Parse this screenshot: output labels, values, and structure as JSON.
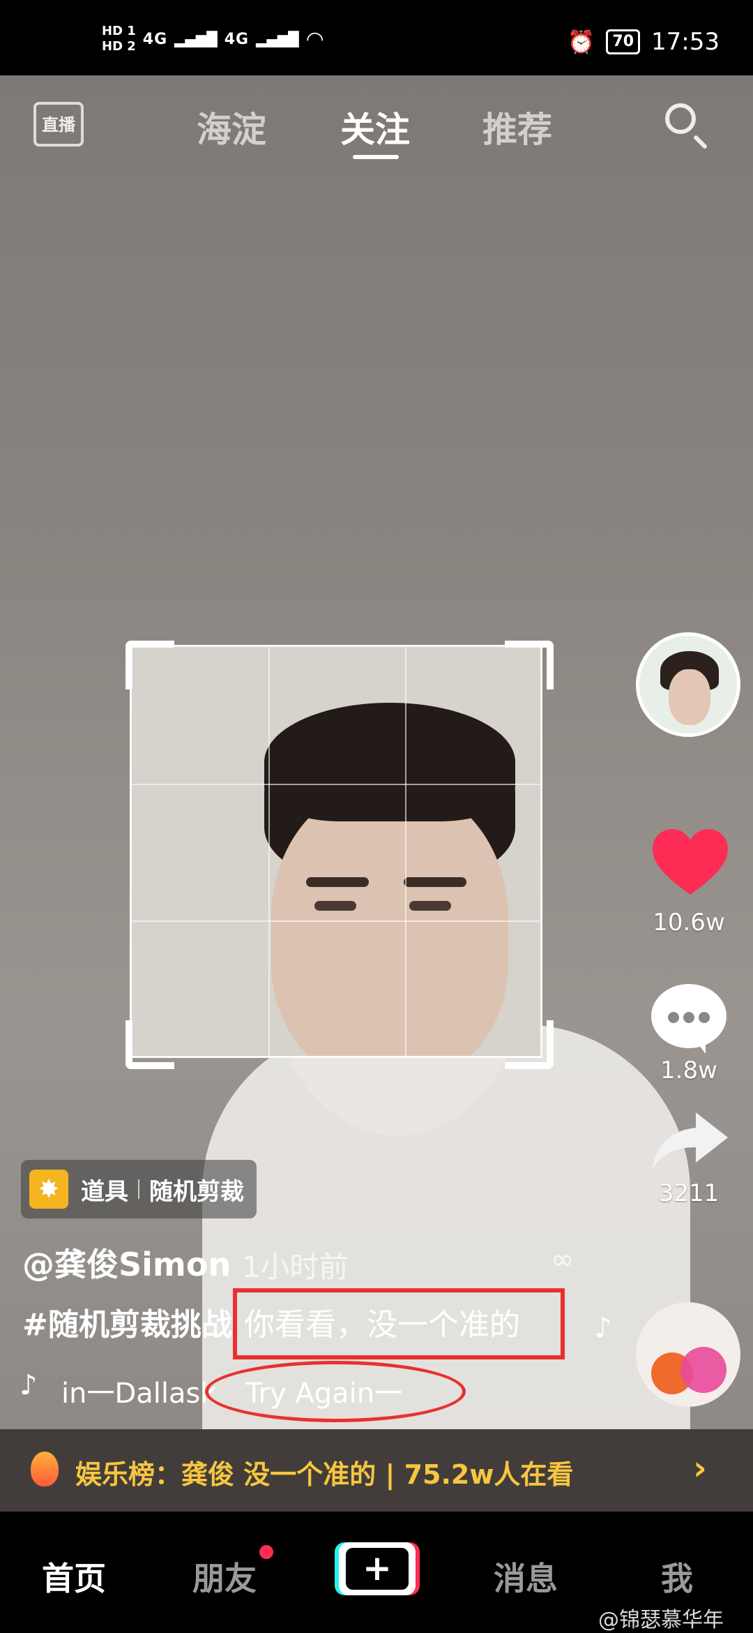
{
  "status_bar": {
    "sim1": "HD 1",
    "sim2": "HD 2",
    "net1": "4G",
    "net2": "4G",
    "battery": "70",
    "time": "17:53"
  },
  "top_nav": {
    "live_label": "直播",
    "tabs": [
      "海淀",
      "关注",
      "推荐"
    ],
    "active_tab": "关注"
  },
  "prop": {
    "label": "道具",
    "name": "随机剪裁"
  },
  "post": {
    "author": "@龚俊Simon",
    "time": "· 1小时前",
    "hashtag": "#随机剪裁挑战",
    "caption": "你看看，没一个准的",
    "song_artist": "in一Dallask",
    "song_title": "Try Again一"
  },
  "actions": {
    "likes": "10.6w",
    "comments": "1.8w",
    "shares": "3211"
  },
  "hot_bar": {
    "text": "娱乐榜：龚俊  没一个准的 | 75.2w人在看",
    "arrow": "›"
  },
  "bottom_tabs": {
    "home": "首页",
    "friends": "朋友",
    "create": "+",
    "messages": "消息",
    "me": "我"
  },
  "watermark": "@锦瑟慕华年",
  "colors": {
    "accent_red": "#fe2c55",
    "annotation_red": "#e8312e",
    "hot_yellow": "#f7c640"
  }
}
